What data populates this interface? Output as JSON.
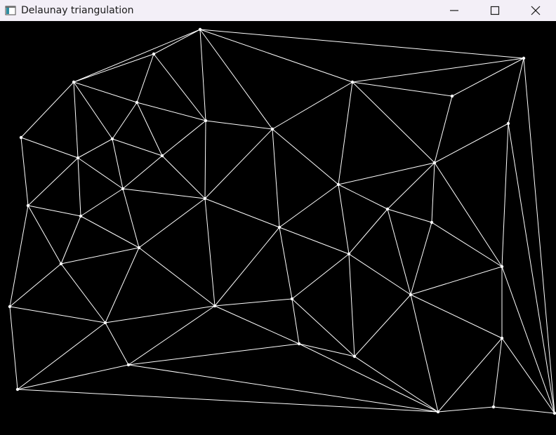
{
  "window": {
    "title": "Delaunay triangulation",
    "icon": "app-window-icon",
    "controls": [
      "minimize-icon",
      "maximize-icon",
      "close-icon"
    ]
  },
  "canvas": {
    "background": "#000000",
    "stroke_color": "#ffffff"
  }
}
